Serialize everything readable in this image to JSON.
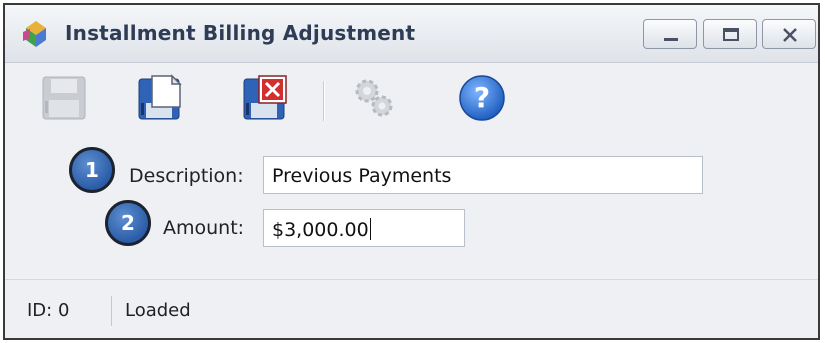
{
  "window": {
    "title": "Installment Billing Adjustment",
    "controls": {
      "minimize": "minimize-icon",
      "maximize": "maximize-icon",
      "close": "close-icon"
    }
  },
  "toolbar": {
    "items": [
      {
        "icon": "save-disk-icon",
        "enabled": false
      },
      {
        "icon": "save-and-new-icon",
        "enabled": true
      },
      {
        "icon": "delete-record-icon",
        "enabled": true
      },
      {
        "icon": "settings-gears-icon",
        "enabled": false
      },
      {
        "icon": "help-icon",
        "enabled": true
      }
    ]
  },
  "form": {
    "callout_1": "1",
    "callout_2": "2",
    "description_label": "Description:",
    "description_value": "Previous Payments",
    "amount_label": "Amount:",
    "amount_value": "$3,000.00"
  },
  "status": {
    "id_text": "ID: 0",
    "state": "Loaded"
  },
  "colors": {
    "title_text": "#2e3d55",
    "callout_fill": "#2b5ca8",
    "help_blue": "#1f6fd0",
    "delete_red": "#d03030"
  }
}
